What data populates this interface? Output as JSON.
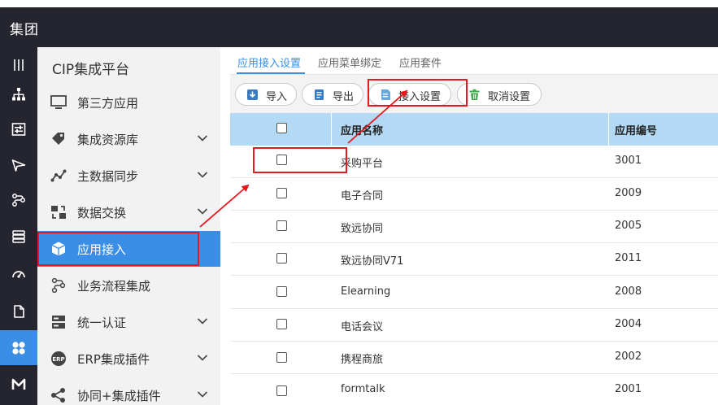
{
  "header": {
    "title": "集团"
  },
  "menu": {
    "title": "CIP集成平台",
    "items": [
      {
        "label": "第三方应用",
        "icon": "monitor-icon",
        "expandable": false
      },
      {
        "label": "集成资源库",
        "icon": "tag-icon",
        "expandable": true
      },
      {
        "label": "主数据同步",
        "icon": "line-chart-icon",
        "expandable": true
      },
      {
        "label": "数据交换",
        "icon": "exchange-icon",
        "expandable": true
      },
      {
        "label": "应用接入",
        "icon": "cube-icon",
        "expandable": false,
        "active": true
      },
      {
        "label": "业务流程集成",
        "icon": "flow-icon",
        "expandable": false
      },
      {
        "label": "统一认证",
        "icon": "server-icon",
        "expandable": true
      },
      {
        "label": "ERP集成插件",
        "icon": "erp-badge-icon",
        "expandable": true
      },
      {
        "label": "协同+集成插件",
        "icon": "share-icon",
        "expandable": true
      }
    ]
  },
  "tabs": [
    {
      "label": "应用接入设置",
      "active": true
    },
    {
      "label": "应用菜单绑定",
      "active": false
    },
    {
      "label": "应用套件",
      "active": false
    }
  ],
  "toolbar": {
    "import_label": "导入",
    "export_label": "导出",
    "access_settings_label": "接入设置",
    "cancel_settings_label": "取消设置"
  },
  "table": {
    "columns": [
      "应用名称",
      "应用编号"
    ],
    "rows": [
      {
        "name": "采购平台",
        "code": "3001"
      },
      {
        "name": "电子合同",
        "code": "2009"
      },
      {
        "name": "致远协同",
        "code": "2005"
      },
      {
        "name": "致远协同V71",
        "code": "2011"
      },
      {
        "name": "Elearning",
        "code": "2008"
      },
      {
        "name": "电话会议",
        "code": "2004"
      },
      {
        "name": "携程商旅",
        "code": "2002"
      },
      {
        "name": "formtalk",
        "code": "2001"
      }
    ]
  },
  "colors": {
    "header_bg": "#252530",
    "accent": "#3a8ee6",
    "grid_header": "#b3d9f4",
    "annotation": "#e8161d"
  }
}
